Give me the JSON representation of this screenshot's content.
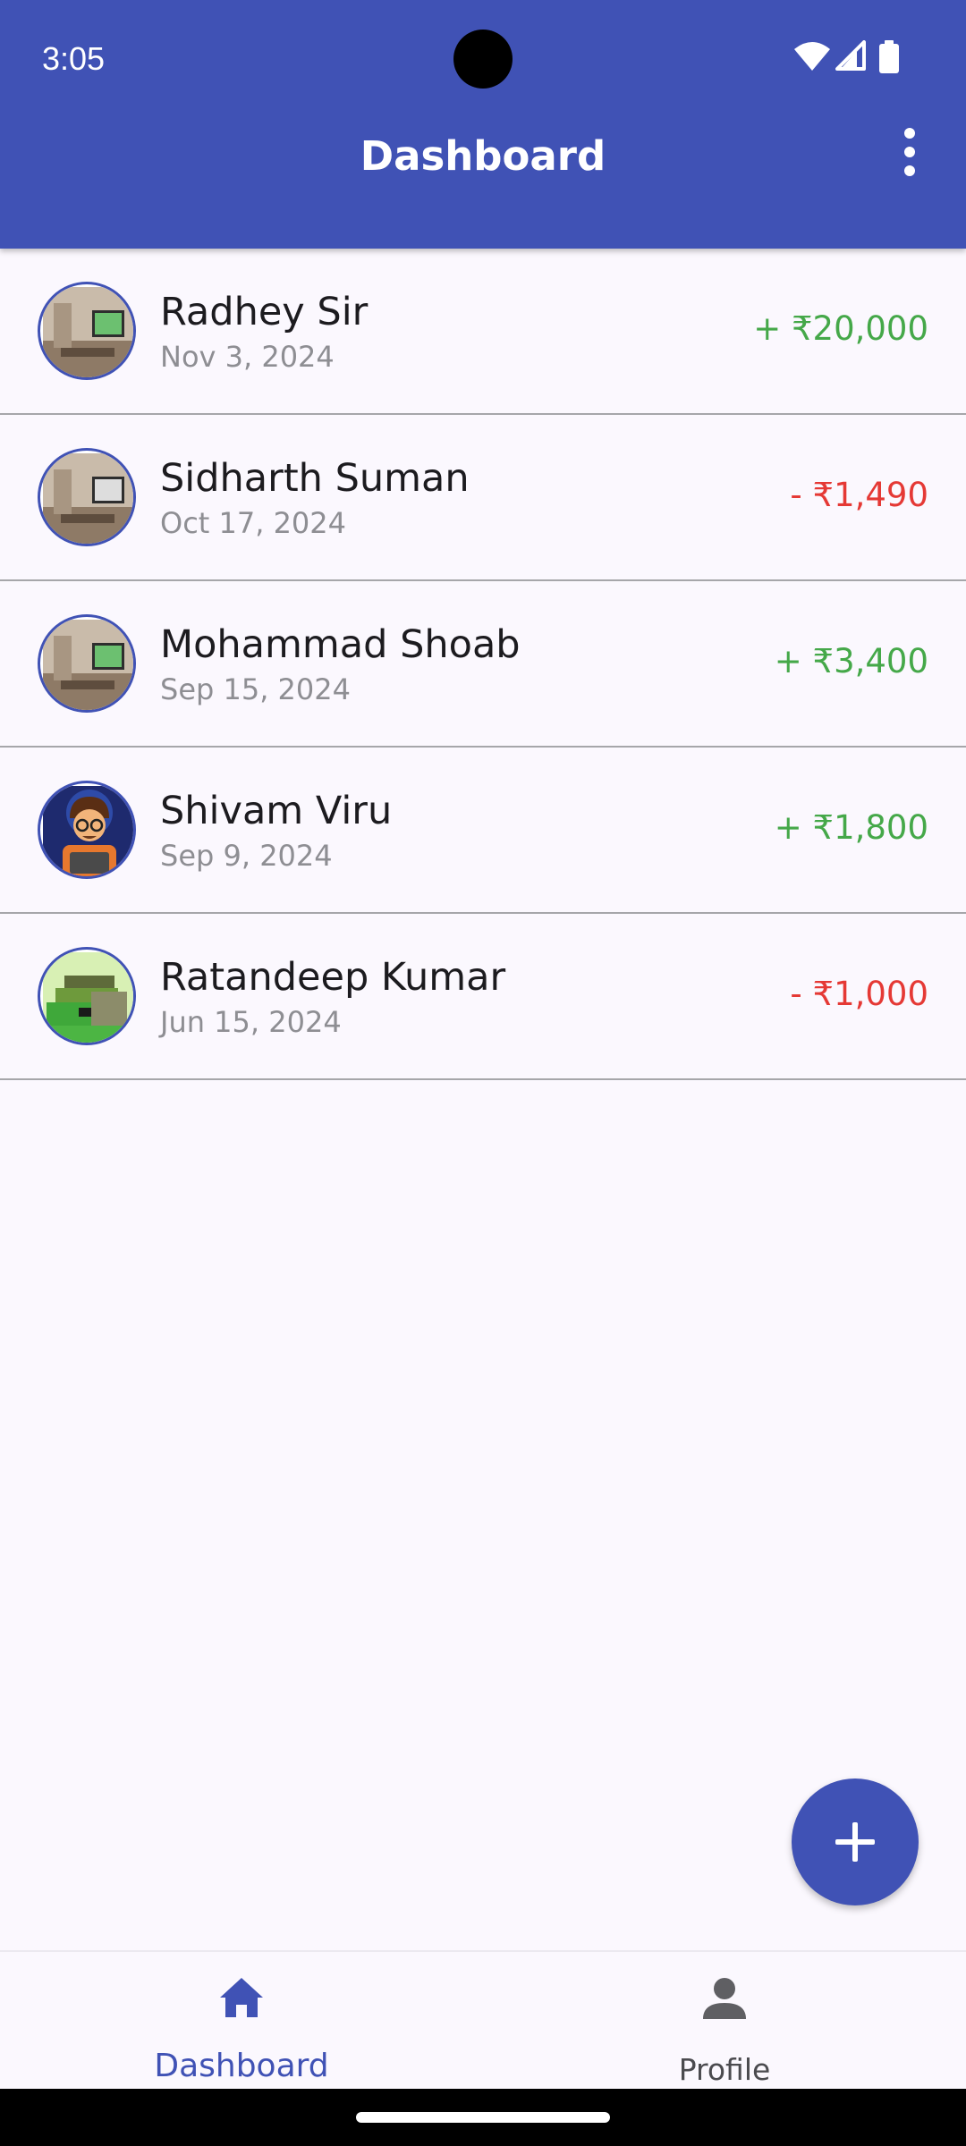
{
  "status_bar": {
    "time": "3:05",
    "icons": [
      "wifi-icon",
      "signal-icon",
      "battery-icon"
    ]
  },
  "app_bar": {
    "title": "Dashboard",
    "menu_icon": "more-vert-icon",
    "background": "#4052B5"
  },
  "transactions": [
    {
      "name": "Radhey Sir",
      "date": "Nov 3, 2024",
      "amount": "+ ₹20,000",
      "type": "credit",
      "avatar": "room-photo"
    },
    {
      "name": "Sidharth Suman",
      "date": "Oct 17, 2024",
      "amount": "- ₹1,490",
      "type": "debit",
      "avatar": "room-photo"
    },
    {
      "name": "Mohammad Shoab",
      "date": "Sep 15, 2024",
      "amount": "+ ₹3,400",
      "type": "credit",
      "avatar": "room-photo"
    },
    {
      "name": "Shivam Viru",
      "date": "Sep 9, 2024",
      "amount": "+ ₹1,800",
      "type": "credit",
      "avatar": "cartoon-character"
    },
    {
      "name": "Ratandeep Kumar",
      "date": "Jun 15, 2024",
      "amount": "- ₹1,000",
      "type": "debit",
      "avatar": "pixel-art"
    }
  ],
  "fab": {
    "icon": "plus-icon"
  },
  "bottom_nav": {
    "items": [
      {
        "label": "Dashboard",
        "icon": "home-icon",
        "active": true
      },
      {
        "label": "Profile",
        "icon": "person-icon",
        "active": false
      }
    ]
  },
  "colors": {
    "accent": "#4052B5",
    "credit": "#45A849",
    "debit": "#E53935",
    "background": "#FBF8FE"
  }
}
